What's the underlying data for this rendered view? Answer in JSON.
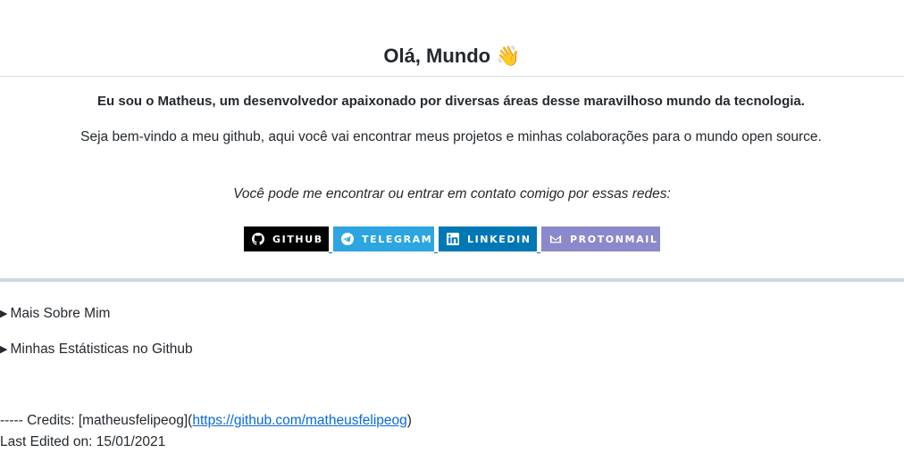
{
  "header": {
    "title": "Olá, Mundo",
    "emoji": "👋"
  },
  "intro": {
    "bold": "Eu sou o Matheus, um desenvolvedor apaixonado por diversas áreas desse maravilhoso mundo da tecnologia.",
    "welcome": "Seja bem-vindo a meu github, aqui você vai encontrar meus projetos e minhas colaborações para o mundo open source.",
    "contact": "Você pode me encontrar ou entrar em contato comigo por essas redes:"
  },
  "badges": [
    {
      "label": "GITHUB",
      "icon": "github-icon",
      "color": "#000000"
    },
    {
      "label": "TELEGRAM",
      "icon": "telegram-icon",
      "color": "#2CA5E0"
    },
    {
      "label": "LINKEDIN",
      "icon": "linkedin-icon",
      "color": "#0077B5"
    },
    {
      "label": "PROTONMAIL",
      "icon": "protonmail-icon",
      "color": "#8B89CC"
    }
  ],
  "sections": [
    {
      "label": "Mais Sobre Mim"
    },
    {
      "label": "Minhas Estátisticas no Github"
    }
  ],
  "footer": {
    "credits_prefix": "----- Credits: [matheusfelipeog](",
    "credits_link": "https://github.com/matheusfelipeog",
    "credits_suffix": ")",
    "last_edited": "Last Edited on: 15/01/2021"
  },
  "colors": {
    "link": "#0969DA",
    "text": "#24292E",
    "rule": "#D0D7DE"
  }
}
